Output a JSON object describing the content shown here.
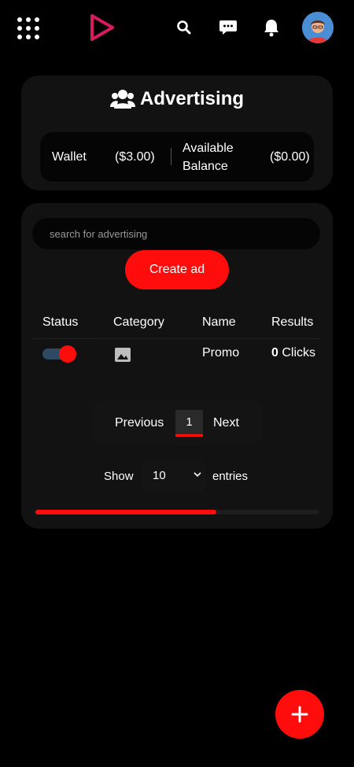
{
  "header": {
    "icons": [
      "apps-grid-icon",
      "play-logo-icon",
      "search-icon",
      "chat-icon",
      "notification-icon",
      "avatar"
    ]
  },
  "advertising": {
    "title": "Advertising",
    "title_icon": "users-icon",
    "wallet_label": "Wallet",
    "wallet_value": "($3.00)",
    "available_label_1": "Available",
    "available_label_2": "Balance",
    "available_value": "($0.00)"
  },
  "search": {
    "placeholder": "search for advertising"
  },
  "create_button": "Create ad",
  "table": {
    "headers": [
      "Status",
      "Category",
      "Name",
      "Results"
    ],
    "rows": [
      {
        "status": "on",
        "category_icon": "image-icon",
        "name": "Promo",
        "results_count": "0",
        "results_unit": "Clicks"
      }
    ]
  },
  "pagination": {
    "previous": "Previous",
    "current_page": "1",
    "next": "Next"
  },
  "entries": {
    "show": "Show",
    "value": "10",
    "suffix": "entries"
  },
  "progress": {
    "fraction": 0.64
  },
  "colors": {
    "accent": "#ff0d0d",
    "background": "#000000",
    "card": "#121212"
  },
  "fab": {
    "icon": "plus-icon"
  }
}
